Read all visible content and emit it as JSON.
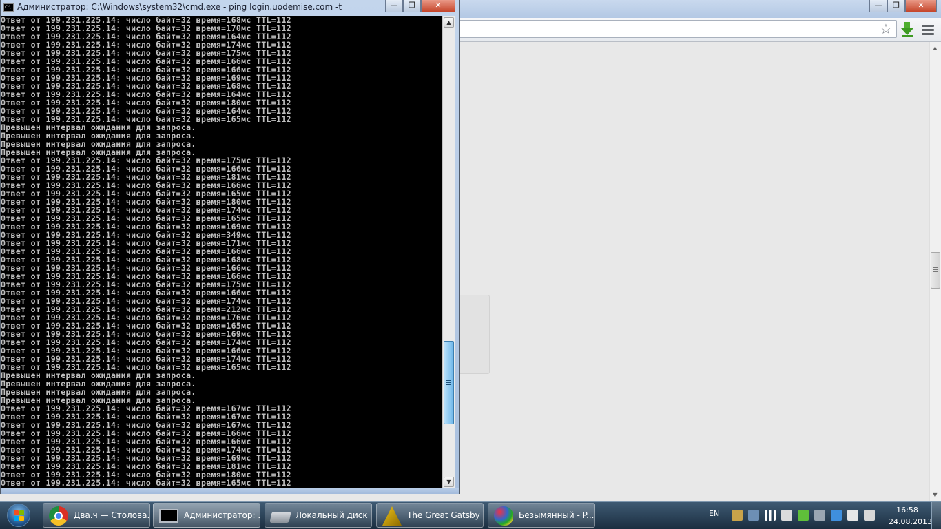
{
  "cmd_window": {
    "title": "Администратор: C:\\Windows\\system32\\cmd.exe - ping  login.uodemise.com -t",
    "lines": [
      "Ответ от 199.231.225.14: число байт=32 время=168мс TTL=112",
      "Ответ от 199.231.225.14: число байт=32 время=170мс TTL=112",
      "Ответ от 199.231.225.14: число байт=32 время=164мс TTL=112",
      "Ответ от 199.231.225.14: число байт=32 время=174мс TTL=112",
      "Ответ от 199.231.225.14: число байт=32 время=175мс TTL=112",
      "Ответ от 199.231.225.14: число байт=32 время=166мс TTL=112",
      "Ответ от 199.231.225.14: число байт=32 время=166мс TTL=112",
      "Ответ от 199.231.225.14: число байт=32 время=169мс TTL=112",
      "Ответ от 199.231.225.14: число байт=32 время=168мс TTL=112",
      "Ответ от 199.231.225.14: число байт=32 время=164мс TTL=112",
      "Ответ от 199.231.225.14: число байт=32 время=180мс TTL=112",
      "Ответ от 199.231.225.14: число байт=32 время=164мс TTL=112",
      "Ответ от 199.231.225.14: число байт=32 время=165мс TTL=112",
      "Превышен интервал ожидания для запроса.",
      "Превышен интервал ожидания для запроса.",
      "Превышен интервал ожидания для запроса.",
      "Превышен интервал ожидания для запроса.",
      "Ответ от 199.231.225.14: число байт=32 время=175мс TTL=112",
      "Ответ от 199.231.225.14: число байт=32 время=166мс TTL=112",
      "Ответ от 199.231.225.14: число байт=32 время=181мс TTL=112",
      "Ответ от 199.231.225.14: число байт=32 время=166мс TTL=112",
      "Ответ от 199.231.225.14: число байт=32 время=165мс TTL=112",
      "Ответ от 199.231.225.14: число байт=32 время=180мс TTL=112",
      "Ответ от 199.231.225.14: число байт=32 время=174мс TTL=112",
      "Ответ от 199.231.225.14: число байт=32 время=165мс TTL=112",
      "Ответ от 199.231.225.14: число байт=32 время=169мс TTL=112",
      "Ответ от 199.231.225.14: число байт=32 время=349мс TTL=112",
      "Ответ от 199.231.225.14: число байт=32 время=171мс TTL=112",
      "Ответ от 199.231.225.14: число байт=32 время=166мс TTL=112",
      "Ответ от 199.231.225.14: число байт=32 время=168мс TTL=112",
      "Ответ от 199.231.225.14: число байт=32 время=166мс TTL=112",
      "Ответ от 199.231.225.14: число байт=32 время=166мс TTL=112",
      "Ответ от 199.231.225.14: число байт=32 время=175мс TTL=112",
      "Ответ от 199.231.225.14: число байт=32 время=166мс TTL=112",
      "Ответ от 199.231.225.14: число байт=32 время=174мс TTL=112",
      "Ответ от 199.231.225.14: число байт=32 время=212мс TTL=112",
      "Ответ от 199.231.225.14: число байт=32 время=176мс TTL=112",
      "Ответ от 199.231.225.14: число байт=32 время=165мс TTL=112",
      "Ответ от 199.231.225.14: число байт=32 время=169мс TTL=112",
      "Ответ от 199.231.225.14: число байт=32 время=174мс TTL=112",
      "Ответ от 199.231.225.14: число байт=32 время=166мс TTL=112",
      "Ответ от 199.231.225.14: число байт=32 время=174мс TTL=112",
      "Ответ от 199.231.225.14: число байт=32 время=165мс TTL=112",
      "Превышен интервал ожидания для запроса.",
      "Превышен интервал ожидания для запроса.",
      "Превышен интервал ожидания для запроса.",
      "Превышен интервал ожидания для запроса.",
      "Ответ от 199.231.225.14: число байт=32 время=167мс TTL=112",
      "Ответ от 199.231.225.14: число байт=32 время=167мс TTL=112",
      "Ответ от 199.231.225.14: число байт=32 время=167мс TTL=112",
      "Ответ от 199.231.225.14: число байт=32 время=166мс TTL=112",
      "Ответ от 199.231.225.14: число байт=32 время=166мс TTL=112",
      "Ответ от 199.231.225.14: число байт=32 время=174мс TTL=112",
      "Ответ от 199.231.225.14: число байт=32 время=169мс TTL=112",
      "Ответ от 199.231.225.14: число байт=32 время=181мс TTL=112",
      "Ответ от 199.231.225.14: число байт=32 время=180мс TTL=112",
      "Ответ от 199.231.225.14: число байт=32 время=165мс TTL=112"
    ],
    "title_icon": "C:\\",
    "minimize_glyph": "—",
    "maximize_glyph": "❐",
    "close_glyph": "✕",
    "scroll_up_glyph": "▲",
    "scroll_down_glyph": "▼"
  },
  "browser_window": {
    "minimize_glyph": "—",
    "maximize_glyph": "❐",
    "close_glyph": "✕",
    "star_glyph": "☆",
    "scroll_up_glyph": "▲",
    "scroll_down_glyph": "▼"
  },
  "taskbar": {
    "items": [
      {
        "label": "Два.ч — Столова...",
        "icon": "chrome-icon"
      },
      {
        "label": "Администратор: ...",
        "icon": "cmd-icon",
        "active": true
      },
      {
        "label": "Локальный диск ...",
        "icon": "disk-icon"
      },
      {
        "label": "The Great Gatsby ...",
        "icon": "book-icon"
      },
      {
        "label": "Безымянный - P...",
        "icon": "paint-icon"
      }
    ],
    "language": "EN",
    "clock_time": "16:58",
    "clock_date": "24.08.2013"
  },
  "colors": {
    "console_bg": "#000000",
    "console_text": "#c0c0c0",
    "taskbar": "#2a4258",
    "cmd_frame": "#b3c8e4"
  }
}
